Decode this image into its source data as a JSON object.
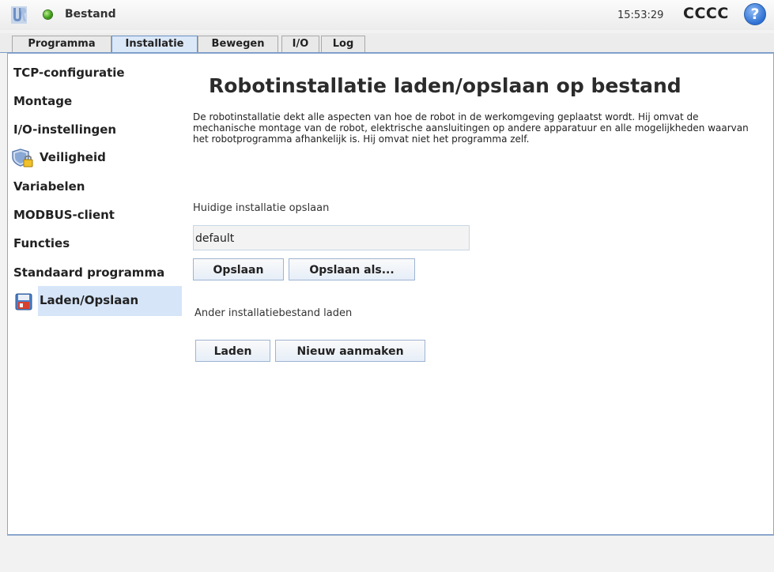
{
  "titlebar": {
    "menu_label": "Bestand",
    "clock": "15:53:29",
    "robot_name": "CCCC",
    "help_glyph": "?"
  },
  "tabs": [
    {
      "label": "Programma",
      "active": false
    },
    {
      "label": "Installatie",
      "active": true
    },
    {
      "label": "Bewegen",
      "active": false
    },
    {
      "label": "I/O",
      "active": false
    },
    {
      "label": "Log",
      "active": false
    }
  ],
  "sidebar": {
    "items": [
      {
        "label": "TCP-configuratie"
      },
      {
        "label": "Montage"
      },
      {
        "label": "I/O-instellingen"
      },
      {
        "label": "Veiligheid",
        "icon": "shield-lock-icon"
      },
      {
        "label": "Variabelen"
      },
      {
        "label": "MODBUS-client"
      },
      {
        "label": "Functies"
      },
      {
        "label": "Standaard programma"
      },
      {
        "label": "Laden/Opslaan",
        "icon": "floppy-disk-icon",
        "selected": true
      }
    ]
  },
  "main": {
    "title": "Robotinstallatie laden/opslaan op bestand",
    "description": "De robotinstallatie dekt alle aspecten van hoe de robot in de werkomgeving geplaatst wordt. Hij omvat de mechanische montage van de robot, elektrische aansluitingen op andere apparatuur en alle mogelijkheden waarvan het robotprogramma afhankelijk is. Hij omvat niet het programma zelf.",
    "save_section_label": "Huidige installatie opslaan",
    "install_name_value": "default",
    "save_button": "Opslaan",
    "save_as_button": "Opslaan als...",
    "load_section_label": "Ander installatiebestand laden",
    "load_button": "Laden",
    "new_button": "Nieuw aanmaken"
  },
  "colors": {
    "accent": "#2d6fd3",
    "selected_bg": "#d6e5f8",
    "status_ok": "#3c9a17",
    "border": "#8ba6cc"
  }
}
